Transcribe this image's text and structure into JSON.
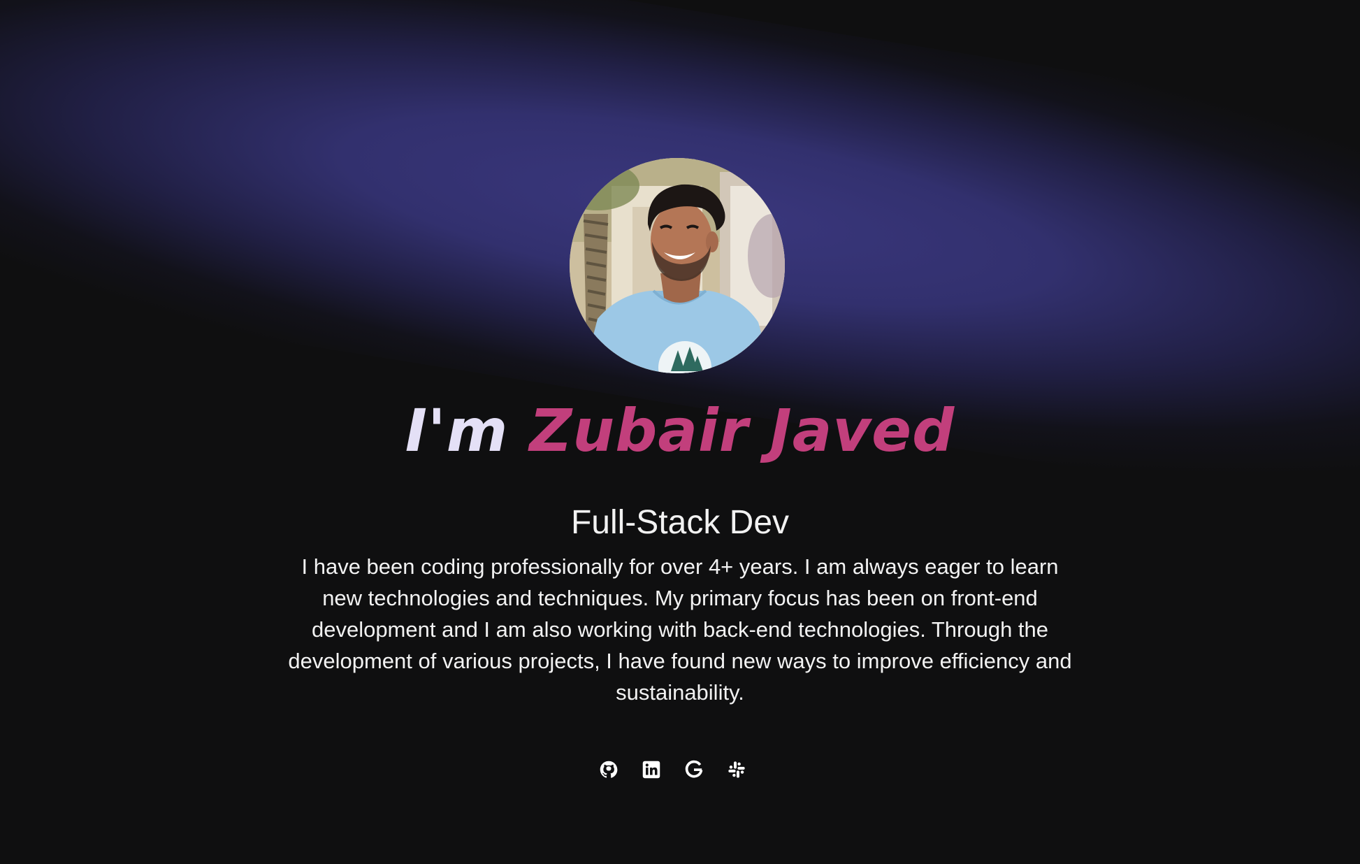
{
  "hero": {
    "heading_intro": "I'm",
    "heading_name": "Zubair Javed",
    "role": "Full-Stack Dev",
    "bio": "I have been coding professionally for over 4+ years. I am always eager to learn new technologies and techniques. My primary focus has been on front-end development and I am also working with back-end technologies. Through the development of various projects, I have found new ways to improve efficiency and sustainability."
  },
  "socials": [
    {
      "icon": "github-icon"
    },
    {
      "icon": "linkedin-icon"
    },
    {
      "icon": "google-icon"
    },
    {
      "icon": "slack-icon"
    }
  ],
  "colors": {
    "background": "#0f0f10",
    "glow": "#36336f",
    "name_accent": "#c23f7c",
    "intro_text": "#e4e0f6"
  }
}
